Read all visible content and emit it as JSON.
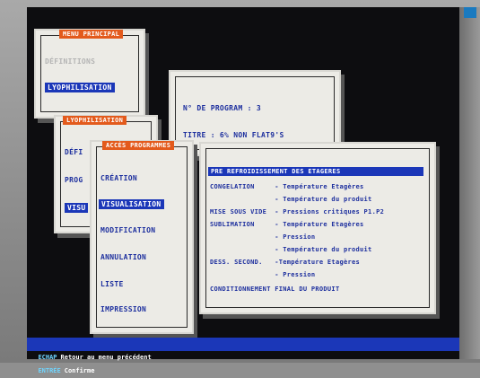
{
  "menu_principal": {
    "title": "MENU PRINCIPAL",
    "items": [
      "DÉFINITIONS",
      "LYOPHILISATION"
    ]
  },
  "lyophilisation_menu": {
    "title": "LYOPHILISATION",
    "items": [
      "DÉFI",
      "PROG",
      "VISU"
    ]
  },
  "acces_programmes": {
    "title": "ACCÈS PROGRAMMES",
    "items": [
      "CRÉATION",
      "VISUALISATION",
      "MODIFICATION",
      "ANNULATION",
      "LISTE",
      "IMPRESSION"
    ],
    "selected": "VISUALISATION"
  },
  "program_info": {
    "number_label": "N° DE PROGRAM : 3",
    "title_label": "TITRE : 6% NON FLAT9'S"
  },
  "detail": {
    "header": "PRE REFROIDISSEMENT DES ETAGERES",
    "rows": [
      "CONGELATION     - Température Etagères",
      "                - Température du produit",
      "MISE SOUS VIDE  - Pressions critiques P1.P2",
      "SUBLIMATION     - Température Etagères",
      "                - Pression",
      "                - Température du produit",
      "DESS. SECOND.   -Température Etagères",
      "                - Pression",
      "CONDITIONNEMENT FINAL DU PRODUIT"
    ]
  },
  "status_bar": {
    "key1": "ECHAP",
    "text1": "Retour au menu précédent",
    "key2": "ENTRÉE",
    "text2": "Confirme"
  },
  "colors": {
    "screen_bg": "#0d0d10",
    "window_bg": "#ecebe6",
    "text_blue": "#1d2f9e",
    "highlight": "#1b37b8",
    "title_orange": "#e35a1c"
  }
}
